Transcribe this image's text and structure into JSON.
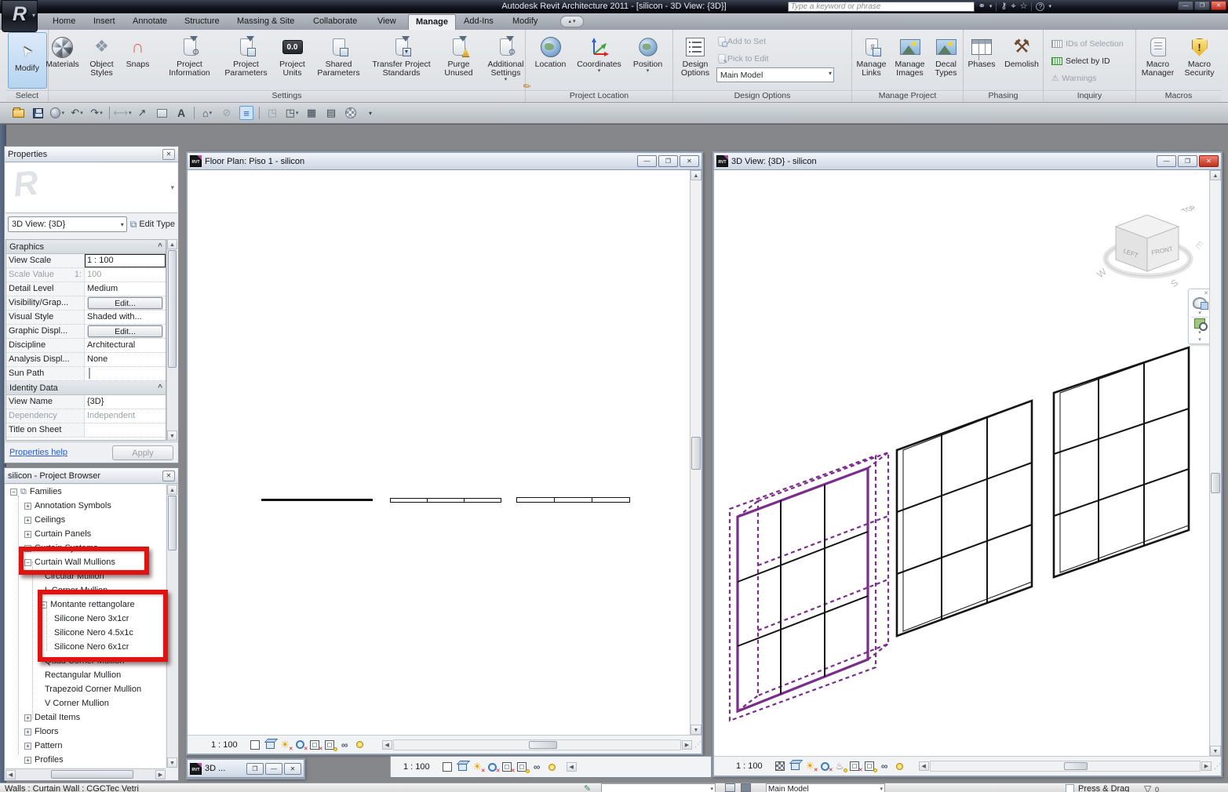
{
  "app": {
    "title": "Autodesk Revit Architecture 2011 - [silicon - 3D View: {3D}]",
    "logo": "R",
    "search_placeholder": "Type a keyword or phrase",
    "file_badge": "RVT"
  },
  "tabs": [
    "Home",
    "Insert",
    "Annotate",
    "Structure",
    "Massing & Site",
    "Collaborate",
    "View",
    "Manage",
    "Add-Ins",
    "Modify"
  ],
  "ribbon": {
    "select": {
      "label": "Select",
      "modify": "Modify"
    },
    "settings": {
      "label": "Settings",
      "materials": "Materials",
      "object_styles": "Object Styles",
      "snaps": "Snaps",
      "project_information": "Project Information",
      "project_parameters": "Project Parameters",
      "project_units": "Project Units",
      "project_units_badge": "0.0",
      "shared_parameters": "Shared Parameters",
      "transfer": "Transfer Project Standards",
      "purge": "Purge Unused",
      "additional": "Additional Settings"
    },
    "location_group": {
      "label": "Project Location",
      "location": "Location",
      "coordinates": "Coordinates",
      "position": "Position"
    },
    "design_options": {
      "label": "Design Options",
      "button": "Design Options",
      "add_to_set": "Add to Set",
      "pick_to_edit": "Pick to Edit",
      "main_model": "Main Model"
    },
    "manage_project": {
      "label": "Manage Project",
      "manage_links": "Manage Links",
      "manage_images": "Manage Images",
      "decal_types": "Decal Types"
    },
    "phasing": {
      "label": "Phasing",
      "phases": "Phases",
      "demolish": "Demolish"
    },
    "inquiry": {
      "label": "Inquiry",
      "ids_of_selection": "IDs of Selection",
      "select_by_id": "Select by ID",
      "warnings": "Warnings"
    },
    "macros": {
      "label": "Macros",
      "macro_manager": "Macro Manager",
      "macro_security": "Macro Security"
    }
  },
  "properties": {
    "title": "Properties",
    "type_selector": "3D View: {3D}",
    "edit_type": "Edit Type",
    "graphics_section": "Graphics",
    "identity_section": "Identity Data",
    "rows": {
      "view_scale": {
        "label": "View Scale",
        "value": "1 : 100"
      },
      "scale_value": {
        "label": "Scale Value",
        "suffix": "1:",
        "value": "100"
      },
      "detail_level": {
        "label": "Detail Level",
        "value": "Medium"
      },
      "visibility": {
        "label": "Visibility/Grap...",
        "value": "Edit..."
      },
      "visual_style": {
        "label": "Visual Style",
        "value": "Shaded with..."
      },
      "graphic_display": {
        "label": "Graphic Displ...",
        "value": "Edit..."
      },
      "discipline": {
        "label": "Discipline",
        "value": "Architectural"
      },
      "analysis": {
        "label": "Analysis Displ...",
        "value": "None"
      },
      "sun_path": {
        "label": "Sun Path"
      },
      "view_name": {
        "label": "View Name",
        "value": "{3D}"
      },
      "dependency": {
        "label": "Dependency",
        "value": "Independent"
      },
      "title_on_sheet": {
        "label": "Title on Sheet",
        "value": ""
      }
    },
    "help_link": "Properties help",
    "apply": "Apply"
  },
  "browser": {
    "title": "silicon - Project Browser",
    "items": [
      "Families",
      "Annotation Symbols",
      "Ceilings",
      "Curtain Panels",
      "Curtain Systems",
      "Curtain Wall Mullions",
      "Circular Mullion",
      "L Corner Mullion",
      "Montante rettangolare",
      "Silicone Nero 3x1cr",
      "Silicone Nero 4.5x1c",
      "Silicone Nero 6x1cr",
      "Quad Corner Mullion",
      "Rectangular Mullion",
      "Trapezoid Corner Mullion",
      "V Corner Mullion",
      "Detail Items",
      "Floors",
      "Pattern",
      "Profiles"
    ]
  },
  "floorplan": {
    "title": "Floor Plan: Piso 1 - silicon",
    "scale": "1 : 100"
  },
  "view3d": {
    "title": "3D View: {3D} - silicon",
    "scale": "1 : 100",
    "viewcube": {
      "top": "TOP",
      "left": "LEFT",
      "front": "FRONT",
      "west": "W",
      "south": "S",
      "east": "E"
    }
  },
  "hidden_window": {
    "title": "3D ...",
    "scale": "1 : 100"
  },
  "statusbar": {
    "selection": "Walls : Curtain Wall : CGCTec Vetri",
    "main_model": "Main Model",
    "press_drag": "Press & Drag",
    "filter_count": "0"
  },
  "colors": {
    "selection_purple": "#7b2d8b",
    "highlight_red": "#e01313",
    "modify_blue": "#b5d4f1"
  },
  "icons": {
    "close": "✕",
    "minimize": "—",
    "restore": "❐",
    "dropdown": "▾",
    "dropup": "▴",
    "up": "▲",
    "down": "▼",
    "left": "◀",
    "right": "▶",
    "plus": "+",
    "minus": "−",
    "collapse": "^",
    "sun": "☀",
    "cross": "✕",
    "cursor": "➤",
    "magnet": "∩",
    "gear": "⚙",
    "pencil": "✎",
    "hammer": "⚒",
    "warning": "⚠",
    "binoculars": "⚭",
    "key": "⚷",
    "target": "⌖",
    "star": "☆",
    "help": "?",
    "undo": "↶",
    "redo": "↷",
    "measure": "⟷",
    "arrow": "↗",
    "text": "A",
    "home": "⌂",
    "section": "⊘",
    "lines": "≡",
    "window": "◳",
    "tile": "▦",
    "panel": "▤",
    "funnel": "▽",
    "glasses": "∞",
    "edit_type": "⧉",
    "families": "⧉",
    "grip": "⋰",
    "link": "∞",
    "diamonds": "❖",
    "exclaim": "!",
    "pot": "♨"
  }
}
